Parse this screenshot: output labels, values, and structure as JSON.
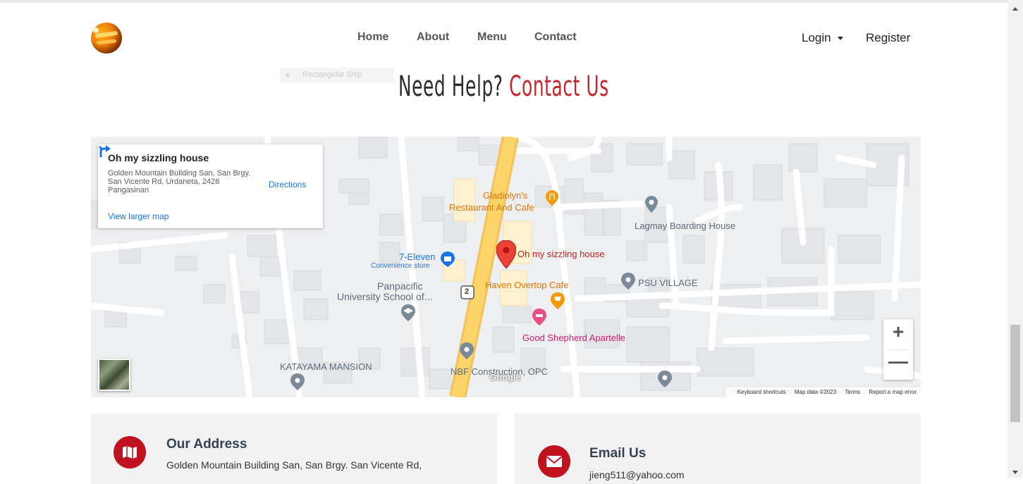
{
  "nav": {
    "items": [
      "Home",
      "About",
      "Menu",
      "Contact"
    ],
    "login": "Login",
    "register": "Register"
  },
  "snip_overlay": "Rectangular Snip",
  "title": {
    "part1": "Need Help?",
    "part2": "Contact Us"
  },
  "map": {
    "card": {
      "name": "Oh my sizzling house",
      "address": "Golden Mountain Building San, San Brgy. San Vicente Rd, Urdaneta, 2428 Pangasinan",
      "directions": "Directions",
      "view_larger": "View larger map"
    },
    "labels": {
      "gladiolyn": "Gladiolyn's",
      "gladiolyn2": "Restaurant And Cafe",
      "lagmay": "Lagmay Boarding House",
      "seven_eleven": "7-Eleven",
      "convenience": "Convenience store",
      "sizzling": "Oh my sizzling house",
      "panpacific1": "Panpacific",
      "panpacific2": "University School of...",
      "route": "2",
      "haven": "Haven Overtop Cafe",
      "psu": "PSU VILLAGE",
      "good_shepherd": "Good Shepherd Apartelle",
      "katayama": "KATAYAMA MANSION",
      "nbf": "NBF Construction, OPC"
    },
    "google": "Google",
    "zoom_in": "+",
    "zoom_out": "—",
    "attribution": [
      "Keyboard shortcuts",
      "Map data ©2023",
      "Terms",
      "Report a map error"
    ],
    "colors": {
      "road_major": "#fdd46a",
      "pin_red": "#ea4335",
      "food_orange": "#f29900",
      "hotel_pink": "#e94f82",
      "poi_grey": "#7b8a98",
      "shop_blue": "#1a73e8"
    }
  },
  "cards": {
    "address": {
      "title": "Our Address",
      "text": "Golden Mountain Building San, San Brgy. San Vicente Rd,"
    },
    "email": {
      "title": "Email Us",
      "text": "jieng511@yahoo.com"
    }
  },
  "icons": {
    "address": "map-icon",
    "email": "envelope-icon"
  },
  "accent": "#c1121f"
}
